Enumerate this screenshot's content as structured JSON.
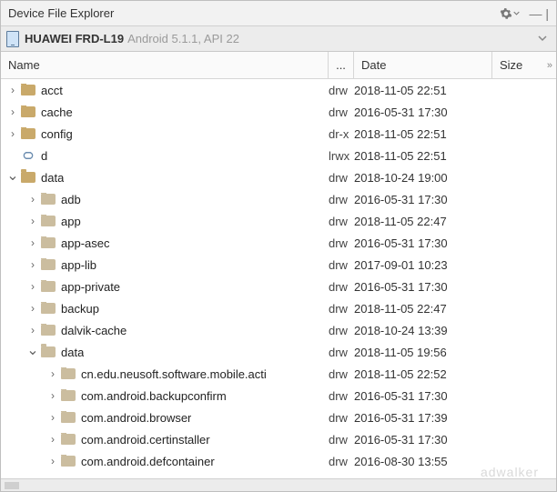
{
  "header": {
    "title": "Device File Explorer"
  },
  "device": {
    "name": "HUAWEI FRD-L19",
    "info": "Android 5.1.1, API 22"
  },
  "columns": {
    "name": "Name",
    "perm": "...",
    "date": "Date",
    "size": "Size"
  },
  "rows": [
    {
      "depth": 0,
      "toggle": ">",
      "icon": "folder",
      "name": "acct",
      "perm": "drw",
      "date": "2018-11-05 22:51"
    },
    {
      "depth": 0,
      "toggle": ">",
      "icon": "folder",
      "name": "cache",
      "perm": "drw",
      "date": "2016-05-31 17:30"
    },
    {
      "depth": 0,
      "toggle": ">",
      "icon": "folder",
      "name": "config",
      "perm": "dr-x",
      "date": "2018-11-05 22:51"
    },
    {
      "depth": 0,
      "toggle": "",
      "icon": "link",
      "name": "d",
      "perm": "lrwx",
      "date": "2018-11-05 22:51"
    },
    {
      "depth": 0,
      "toggle": "v",
      "icon": "folder",
      "name": "data",
      "perm": "drw",
      "date": "2018-10-24 19:00"
    },
    {
      "depth": 1,
      "toggle": ">",
      "icon": "folder-dim",
      "name": "adb",
      "perm": "drw",
      "date": "2016-05-31 17:30"
    },
    {
      "depth": 1,
      "toggle": ">",
      "icon": "folder-dim",
      "name": "app",
      "perm": "drw",
      "date": "2018-11-05 22:47"
    },
    {
      "depth": 1,
      "toggle": ">",
      "icon": "folder-dim",
      "name": "app-asec",
      "perm": "drw",
      "date": "2016-05-31 17:30"
    },
    {
      "depth": 1,
      "toggle": ">",
      "icon": "folder-dim",
      "name": "app-lib",
      "perm": "drw",
      "date": "2017-09-01 10:23"
    },
    {
      "depth": 1,
      "toggle": ">",
      "icon": "folder-dim",
      "name": "app-private",
      "perm": "drw",
      "date": "2016-05-31 17:30"
    },
    {
      "depth": 1,
      "toggle": ">",
      "icon": "folder-dim",
      "name": "backup",
      "perm": "drw",
      "date": "2018-11-05 22:47"
    },
    {
      "depth": 1,
      "toggle": ">",
      "icon": "folder-dim",
      "name": "dalvik-cache",
      "perm": "drw",
      "date": "2018-10-24 13:39"
    },
    {
      "depth": 1,
      "toggle": "v",
      "icon": "folder-dim",
      "name": "data",
      "perm": "drw",
      "date": "2018-11-05 19:56"
    },
    {
      "depth": 2,
      "toggle": ">",
      "icon": "folder-dim",
      "name": "cn.edu.neusoft.software.mobile.acti",
      "perm": "drw",
      "date": "2018-11-05 22:52"
    },
    {
      "depth": 2,
      "toggle": ">",
      "icon": "folder-dim",
      "name": "com.android.backupconfirm",
      "perm": "drw",
      "date": "2016-05-31 17:30"
    },
    {
      "depth": 2,
      "toggle": ">",
      "icon": "folder-dim",
      "name": "com.android.browser",
      "perm": "drw",
      "date": "2016-05-31 17:39"
    },
    {
      "depth": 2,
      "toggle": ">",
      "icon": "folder-dim",
      "name": "com.android.certinstaller",
      "perm": "drw",
      "date": "2016-05-31 17:30"
    },
    {
      "depth": 2,
      "toggle": ">",
      "icon": "folder-dim",
      "name": "com.android.defcontainer",
      "perm": "drw",
      "date": "2016-08-30 13:55"
    }
  ],
  "watermark": "adwalker"
}
